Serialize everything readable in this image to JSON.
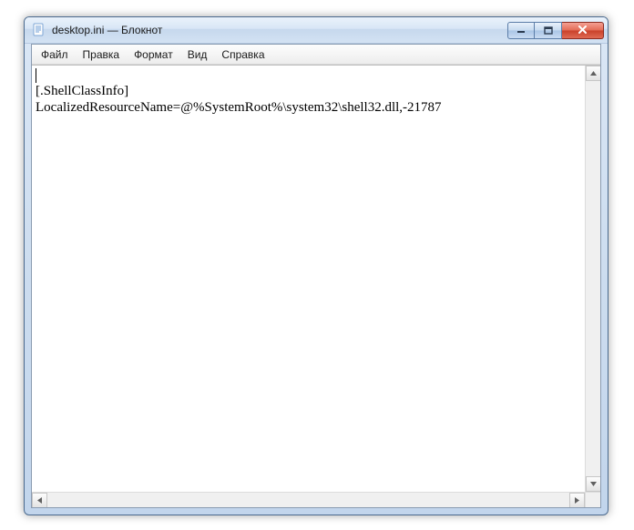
{
  "window": {
    "title": "desktop.ini — Блокнот"
  },
  "menu": {
    "items": [
      {
        "label": "Файл"
      },
      {
        "label": "Правка"
      },
      {
        "label": "Формат"
      },
      {
        "label": "Вид"
      },
      {
        "label": "Справка"
      }
    ]
  },
  "document": {
    "lines": [
      "",
      "[.ShellClassInfo]",
      "LocalizedResourceName=@%SystemRoot%\\system32\\shell32.dll,-21787"
    ]
  }
}
